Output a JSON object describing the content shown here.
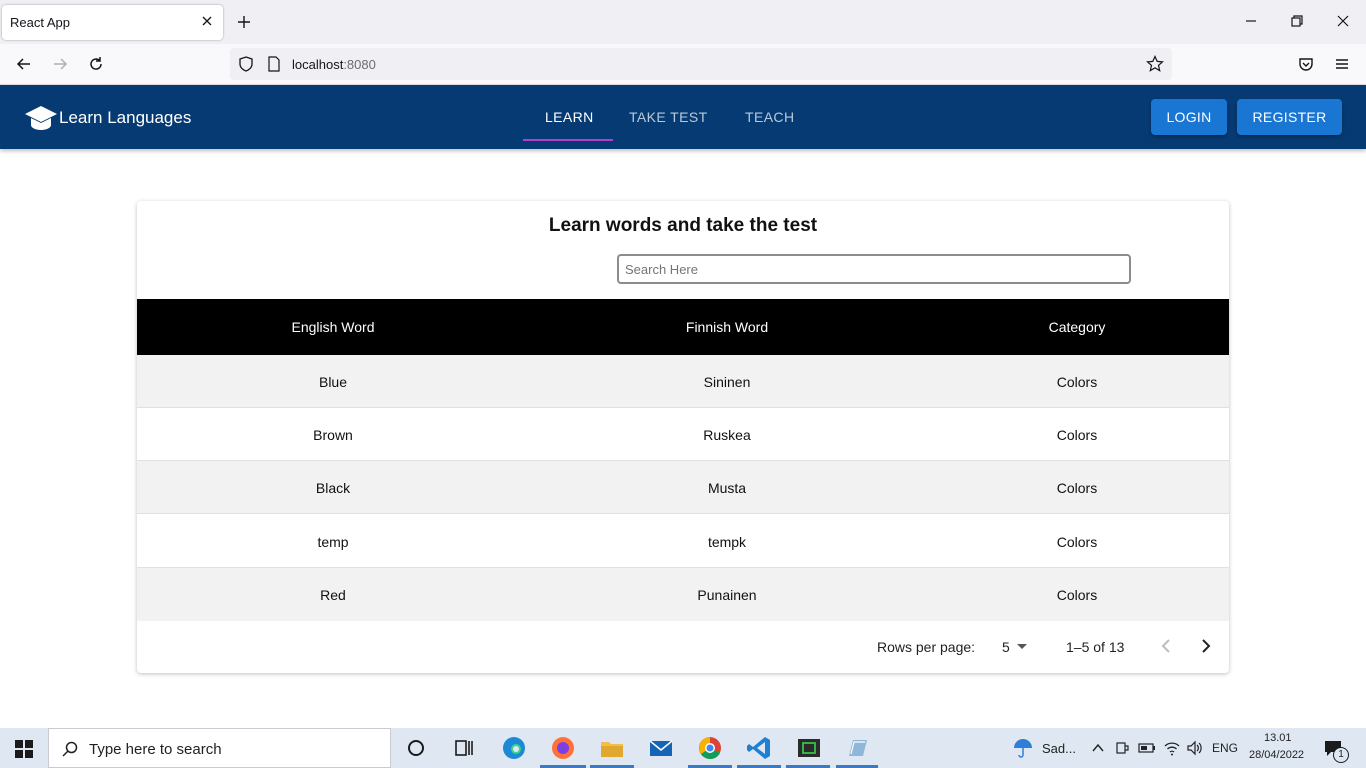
{
  "browser": {
    "tab_title": "React App",
    "url_host": "localhost",
    "url_port": ":8080"
  },
  "app": {
    "brand": "Learn Languages",
    "tabs": [
      {
        "label": "LEARN",
        "active": true
      },
      {
        "label": "TAKE TEST",
        "active": false
      },
      {
        "label": "TEACH",
        "active": false
      }
    ],
    "login_label": "LOGIN",
    "register_label": "REGISTER",
    "colors": {
      "appbar": "#063a73",
      "button": "#1976d2",
      "indicator": "#b23fd0"
    }
  },
  "card": {
    "title": "Learn words and take the test",
    "search_placeholder": "Search Here",
    "columns": [
      "English Word",
      "Finnish Word",
      "Category"
    ],
    "rows": [
      {
        "english": "Blue",
        "finnish": "Sininen",
        "category": "Colors"
      },
      {
        "english": "Brown",
        "finnish": "Ruskea",
        "category": "Colors"
      },
      {
        "english": "Black",
        "finnish": "Musta",
        "category": "Colors"
      },
      {
        "english": "temp",
        "finnish": "tempk",
        "category": "Colors"
      },
      {
        "english": "Red",
        "finnish": "Punainen",
        "category": "Colors"
      }
    ],
    "pagination": {
      "rows_per_page_label": "Rows per page:",
      "rows_per_page": "5",
      "range": "1–5 of 13"
    }
  },
  "taskbar": {
    "search_placeholder": "Type here to search",
    "weather": "Sad...",
    "language": "ENG",
    "time": "13.01",
    "date": "28/04/2022",
    "notification_count": "1"
  }
}
